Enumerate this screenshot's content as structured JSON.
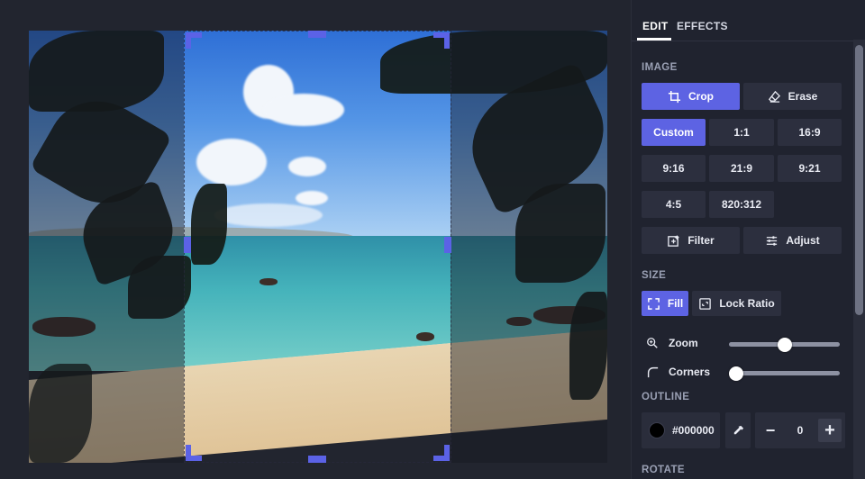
{
  "tabs": {
    "edit": "EDIT",
    "effects": "EFFECTS",
    "active": "edit"
  },
  "image_section": {
    "label": "IMAGE",
    "crop": "Crop",
    "erase": "Erase",
    "ratios": [
      "Custom",
      "1:1",
      "16:9",
      "9:16",
      "21:9",
      "9:21",
      "4:5",
      "820:312"
    ],
    "selected_ratio": "Custom",
    "filter": "Filter",
    "adjust": "Adjust"
  },
  "size_section": {
    "label": "SIZE",
    "fill": "Fill",
    "lock_ratio": "Lock Ratio",
    "zoom_label": "Zoom",
    "zoom_value": 0.5,
    "corners_label": "Corners",
    "corners_value": 0
  },
  "outline_section": {
    "label": "OUTLINE",
    "color": "#000000",
    "width_value": "0"
  },
  "rotate_section": {
    "label": "ROTATE"
  },
  "colors": {
    "accent": "#5d63e3",
    "panel": "#20232f",
    "canvas": "#22252f"
  },
  "crop": {
    "ratio_mode": "Custom"
  }
}
